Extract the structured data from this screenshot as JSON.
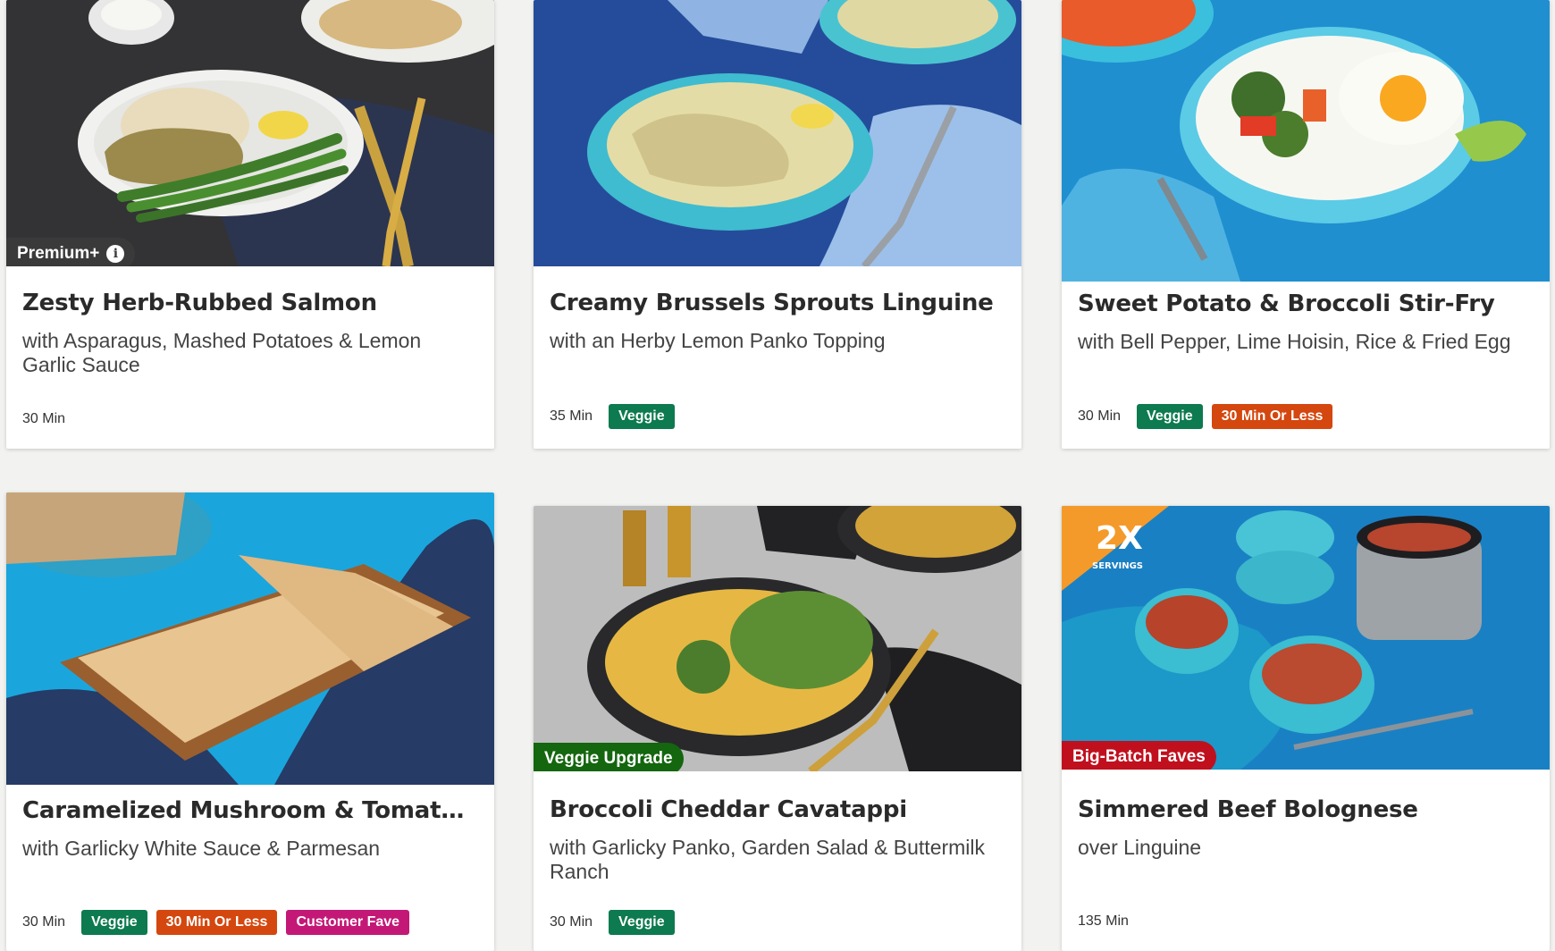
{
  "recipes": [
    {
      "title": "Zesty Herb-Rubbed Salmon",
      "subtitle": "with Asparagus, Mashed Potatoes & Lemon Garlic Sauce",
      "time": "30 Min",
      "badge": "Premium+",
      "tags": []
    },
    {
      "title": "Creamy Brussels Sprouts Linguine",
      "subtitle": "with an Herby Lemon Panko Topping",
      "time": "35 Min",
      "tags": [
        "Veggie"
      ]
    },
    {
      "title": "Sweet Potato & Broccoli Stir-Fry",
      "subtitle": "with Bell Pepper, Lime Hoisin, Rice & Fried Egg",
      "time": "30 Min",
      "tags": [
        "Veggie",
        "30 Min Or Less"
      ]
    },
    {
      "title": "Caramelized Mushroom & Tomato Fla...",
      "subtitle": "with Garlicky White Sauce & Parmesan",
      "time": "30 Min",
      "tags": [
        "Veggie",
        "30 Min Or Less",
        "Customer Fave"
      ]
    },
    {
      "title": "Broccoli Cheddar Cavatappi",
      "subtitle": "with Garlicky Panko, Garden Salad & Buttermilk Ranch",
      "time": "30 Min",
      "badge": "Veggie Upgrade",
      "tags": [
        "Veggie"
      ]
    },
    {
      "title": "Simmered Beef Bolognese",
      "subtitle": "over Linguine",
      "time": "135 Min",
      "badge": "Big-Batch Faves",
      "image_text": {
        "big": "2X",
        "small": "SERVINGS"
      },
      "tags": []
    }
  ],
  "colors": {
    "veggie": "#0d7a4f",
    "quick": "#d4470f",
    "fave": "#c41876",
    "premium": "#3a3a3a",
    "upgrade": "#14660f",
    "batch": "#c0101e"
  }
}
